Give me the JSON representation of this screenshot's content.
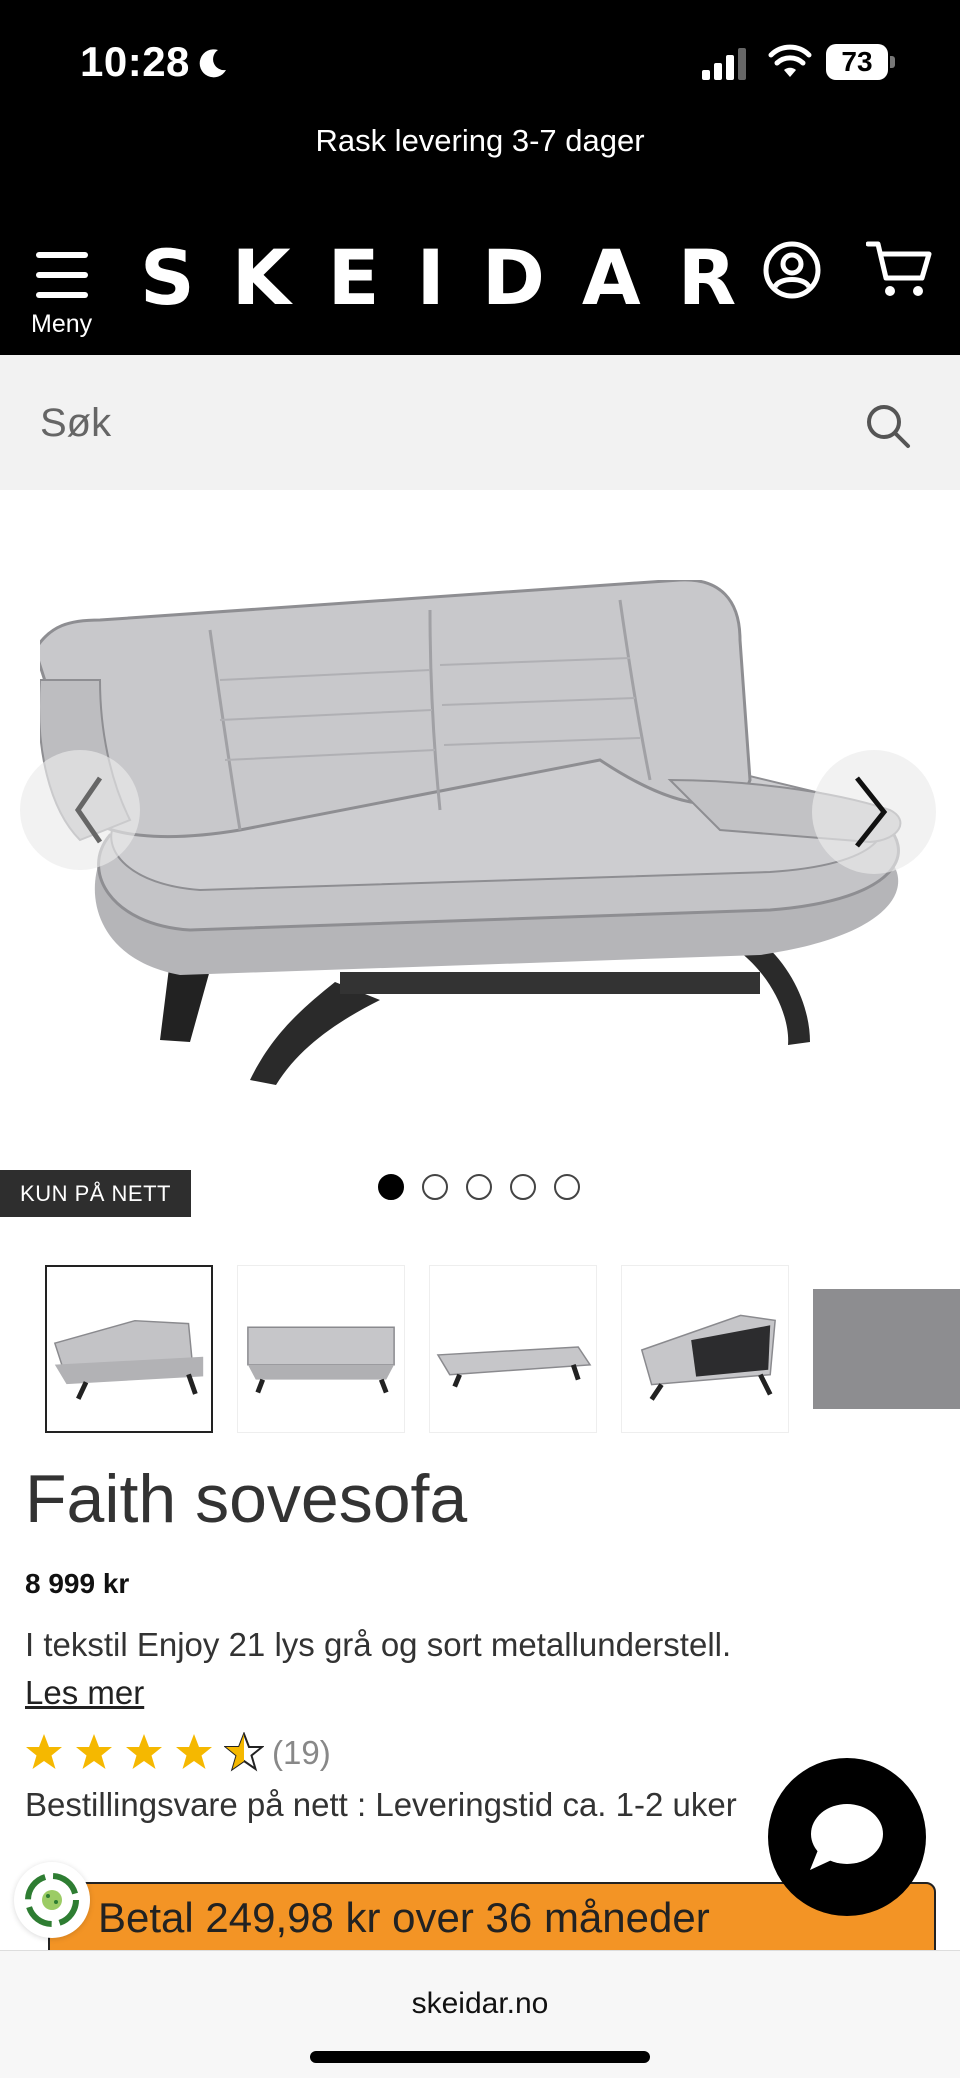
{
  "status_bar": {
    "time": "10:28",
    "battery": "73"
  },
  "promo": {
    "text": "Rask levering 3-7 dager"
  },
  "header": {
    "logo": "SKEIDAR",
    "menu_label": "Meny"
  },
  "search": {
    "placeholder": "Søk"
  },
  "gallery": {
    "badge": "KUN PÅ NETT",
    "image_count": 5,
    "active_index": 0
  },
  "product": {
    "title": "Faith sovesofa",
    "price": "8 999 kr",
    "description": "I tekstil Enjoy 21 lys grå og sort metallunderstell.",
    "read_more": "Les mer",
    "rating": 4.5,
    "rating_count": "(19)",
    "availability": "Bestillingsvare på nett : Leveringstid ca. 1-2 uker"
  },
  "payment": {
    "text": "Betal 249,98 kr over 36 måneder"
  },
  "browser": {
    "url": "skeidar.no"
  },
  "colors": {
    "accent": "#f39425",
    "header_bg": "#000000",
    "search_bg": "#f2f2f2"
  },
  "icons": [
    "moon-icon",
    "signal-icon",
    "wifi-icon",
    "battery-icon",
    "menu-icon",
    "account-icon",
    "cart-icon",
    "search-icon",
    "chevron-left-icon",
    "chevron-right-icon",
    "star-icon",
    "recycle-icon",
    "chat-icon"
  ]
}
